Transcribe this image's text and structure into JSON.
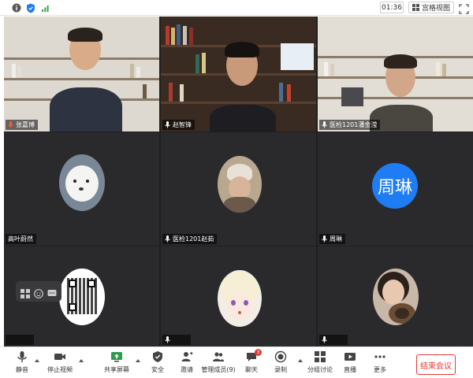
{
  "topbar": {
    "timer": "01:36",
    "view_mode": "宫格视图"
  },
  "participants": [
    {
      "name": "张嘉博"
    },
    {
      "name": "赵智锋"
    },
    {
      "name": "医检1201潘金滢"
    },
    {
      "name": "高叶蔚然"
    },
    {
      "name": "医检1201赵茹"
    },
    {
      "name": "周琳",
      "avatar_text": "周琳"
    },
    {
      "name": ""
    },
    {
      "name": ""
    },
    {
      "name": ""
    }
  ],
  "toolbar": {
    "mute": "静音",
    "stop_video": "停止视频",
    "share_screen": "共享屏幕",
    "security": "安全",
    "invite": "邀请",
    "manage_members": "管理成员(9)",
    "chat": "聊天",
    "chat_badge": "3",
    "record": "录制",
    "breakout": "分组讨论",
    "live": "直播",
    "more": "更多",
    "end_meeting": "结束会议"
  },
  "colors": {
    "accent": "#1e7cf5",
    "danger": "#e53935",
    "tile_bg": "#2a2a2c"
  }
}
